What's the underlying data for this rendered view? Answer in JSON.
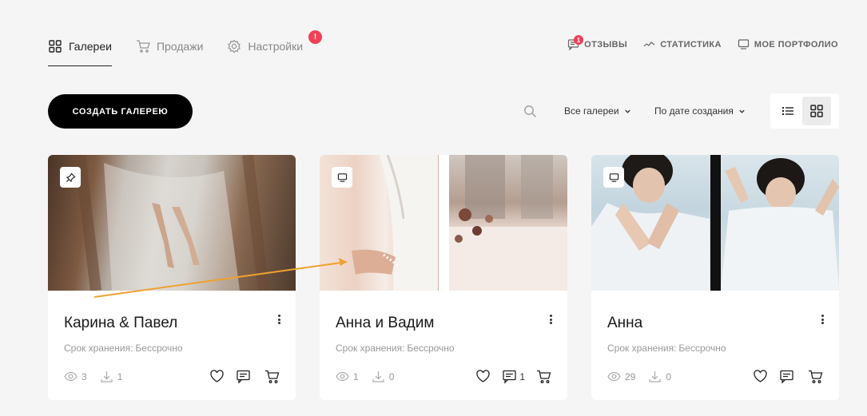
{
  "nav": {
    "galleries": "Галереи",
    "sales": "Продажи",
    "settings": "Настройки",
    "settings_alert": "!"
  },
  "right_nav": {
    "reviews": "ОТЗЫВЫ",
    "reviews_badge": "1",
    "stats": "СТАТИСТИКА",
    "portfolio": "МОЕ ПОРТФОЛИО"
  },
  "toolbar": {
    "create_label": "СОЗДАТЬ ГАЛЕРЕЮ",
    "filter_value": "Все галереи",
    "sort_value": "По дате создания"
  },
  "colors": {
    "accent_red": "#ef4055",
    "annotation_arrow": "#f0a030"
  },
  "storage_label": "Срок хранения:",
  "cards": [
    {
      "title": "Карина & Павел",
      "storage_value": "Бессрочно",
      "views": "3",
      "downloads": "1",
      "comments": "",
      "badge_icon": "pin-icon"
    },
    {
      "title": "Анна и Вадим",
      "storage_value": "Бессрочно",
      "views": "1",
      "downloads": "0",
      "comments": "1",
      "badge_icon": "monitor-icon"
    },
    {
      "title": "Анна",
      "storage_value": "Бессрочно",
      "views": "29",
      "downloads": "0",
      "comments": "",
      "badge_icon": "monitor-icon"
    }
  ]
}
